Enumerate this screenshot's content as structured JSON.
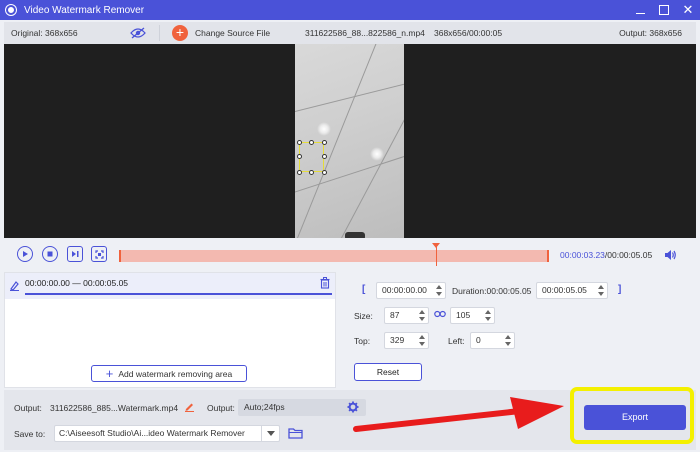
{
  "window": {
    "title": "Video Watermark Remover"
  },
  "infobar": {
    "original_size": "Original: 368x656",
    "change_source_label": "Change Source File",
    "file_name": "311622586_88...822586_n.mp4",
    "file_meta": "368x656/00:00:05",
    "output_size": "Output: 368x656"
  },
  "timeline": {
    "current_time": "00:00:03.23",
    "total_time": "/00:00:05.05",
    "playhead_fraction": 0.74
  },
  "segment": {
    "time_range": "00:00:00.00 — 00:00:05.05"
  },
  "left_panel": {
    "add_area_label": "Add watermark removing area"
  },
  "area_settings": {
    "start_time": "00:00:00.00",
    "duration_label": "Duration:00:00:05.05",
    "end_time": "00:00:05.05",
    "size_label": "Size:",
    "width": "87",
    "height": "105",
    "top_label": "Top:",
    "top": "329",
    "left_label": "Left:",
    "left": "0",
    "reset_label": "Reset"
  },
  "bottom": {
    "output_label": "Output:",
    "output_file": "311622586_885...Watermark.mp4",
    "output_format_label": "Output:",
    "output_format": "Auto;24fps",
    "save_to_label": "Save to:",
    "save_path": "C:\\Aiseesoft Studio\\Ai...ideo Watermark Remover",
    "export_label": "Export"
  },
  "colors": {
    "accent": "#4a52d8",
    "track": "#f3b9b0",
    "playhead": "#f0623d",
    "highlight": "#f4f000",
    "arrow": "#e81c1c"
  }
}
